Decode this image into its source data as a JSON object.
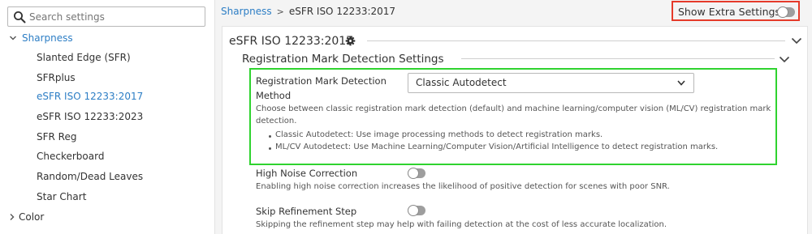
{
  "sidebar": {
    "search_placeholder": "Search settings",
    "items": [
      {
        "label": "Sharpness"
      },
      {
        "label": "Slanted Edge (SFR)"
      },
      {
        "label": "SFRplus"
      },
      {
        "label": "eSFR ISO 12233:2017"
      },
      {
        "label": "eSFR ISO 12233:2023"
      },
      {
        "label": "SFR Reg"
      },
      {
        "label": "Checkerboard"
      },
      {
        "label": "Random/Dead Leaves"
      },
      {
        "label": "Star Chart"
      },
      {
        "label": "Color"
      }
    ]
  },
  "breadcrumb": {
    "root": "Sharpness",
    "separator": ">",
    "current": "eSFR ISO 12233:2017"
  },
  "extra_settings": {
    "label": "Show Extra Settings",
    "enabled": false
  },
  "panel": {
    "title": "eSFR ISO 12233:2017",
    "section_title": "Registration Mark Detection Settings",
    "method": {
      "label_line1": "Registration Mark Detection",
      "label_line2": "Method",
      "selected": "Classic Autodetect",
      "description_line1": "Choose between classic registration mark detection (default) and machine learning/computer vision (ML/CV) registration mark",
      "description_line2": "detection.",
      "bullets": [
        "Classic Autodetect: Use image processing methods to detect registration marks.",
        "ML/CV Autodetect: Use Machine Learning/Computer Vision/Artificial Intelligence to detect registration marks."
      ]
    },
    "high_noise": {
      "label": "High Noise Correction",
      "enabled": false,
      "description": "Enabling high noise correction increases the likelihood of positive detection for scenes with poor SNR."
    },
    "skip_refinement": {
      "label": "Skip Refinement Step",
      "enabled": false,
      "description": "Skipping the refinement step may help with failing detection at the cost of less accurate localization."
    }
  },
  "colors": {
    "accent": "#2d7ec5",
    "highlight_red": "#e53a2a",
    "highlight_green": "#2fd32f"
  }
}
